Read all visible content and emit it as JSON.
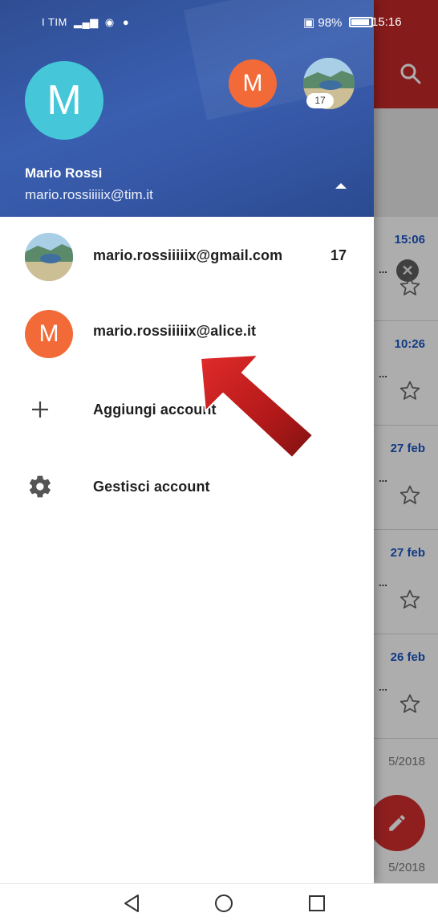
{
  "statusbar": {
    "left_status": "I TIM",
    "battery": "98%",
    "time": "15:16"
  },
  "drawer": {
    "header": {
      "avatar_letter": "M",
      "secondary_avatar_letter": "M",
      "photo_badge_count": "17",
      "name": "Mario Rossi",
      "email": "mario.rossiiiiix@tim.it"
    },
    "accounts": [
      {
        "email": "mario.rossiiiiix@gmail.com",
        "count": "17",
        "avatar": "photo"
      },
      {
        "email": "mario.rossiiiiix@alice.it",
        "avatar_letter": "M"
      }
    ],
    "actions": {
      "add_account": "Aggiungi account",
      "manage_accounts": "Gestisci account"
    }
  },
  "background": {
    "dates": [
      "15:06",
      "10:26",
      "27 feb",
      "27 feb",
      "26 feb",
      "5/2018",
      "5/2018"
    ]
  },
  "icons": {
    "search": "search-icon",
    "close": "close-icon",
    "star": "star-outline-icon",
    "pencil": "pencil-icon",
    "plus": "plus-icon",
    "gear": "gear-icon",
    "collapse": "triangle-up-icon",
    "back": "back-triangle-icon",
    "home": "home-circle-icon",
    "recents": "recents-square-icon"
  },
  "colors": {
    "header_blue": "#3556a4",
    "toolbar_red": "#c62828",
    "avatar_cyan": "#45c7d9",
    "avatar_orange": "#f26a37",
    "date_blue": "#1a56c4"
  }
}
